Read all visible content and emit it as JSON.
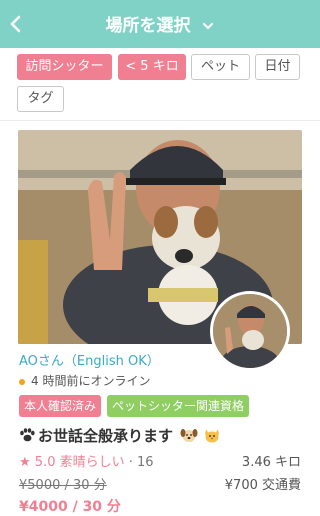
{
  "header": {
    "title": "場所を選択",
    "bg_color": "#7fd2c5"
  },
  "filters": [
    {
      "label": "訪問シッター",
      "active": true
    },
    {
      "label": "< 5 キロ",
      "active": true
    },
    {
      "label": "ペット",
      "active": false
    },
    {
      "label": "日付",
      "active": false
    },
    {
      "label": "タグ",
      "active": false
    }
  ],
  "sitter": {
    "name": "AOさん（English OK）",
    "online": "4 時間前にオンライン",
    "badges": [
      "本人確認済み",
      "ペットシッター関連資格"
    ],
    "service": "お世話全般承ります",
    "rating_text": "★ 5.0 素晴らしい",
    "review_count": "· 16",
    "distance": "3.46 キロ",
    "old_price": "¥5000 / 30 分",
    "transport": "¥700 交通費",
    "price": "¥4000 / 30 分"
  },
  "colors": {
    "accent_pink": "#f07f92",
    "accent_green": "#8fcf62",
    "link_blue": "#3da9c7",
    "online_dot": "#f0a21a"
  }
}
